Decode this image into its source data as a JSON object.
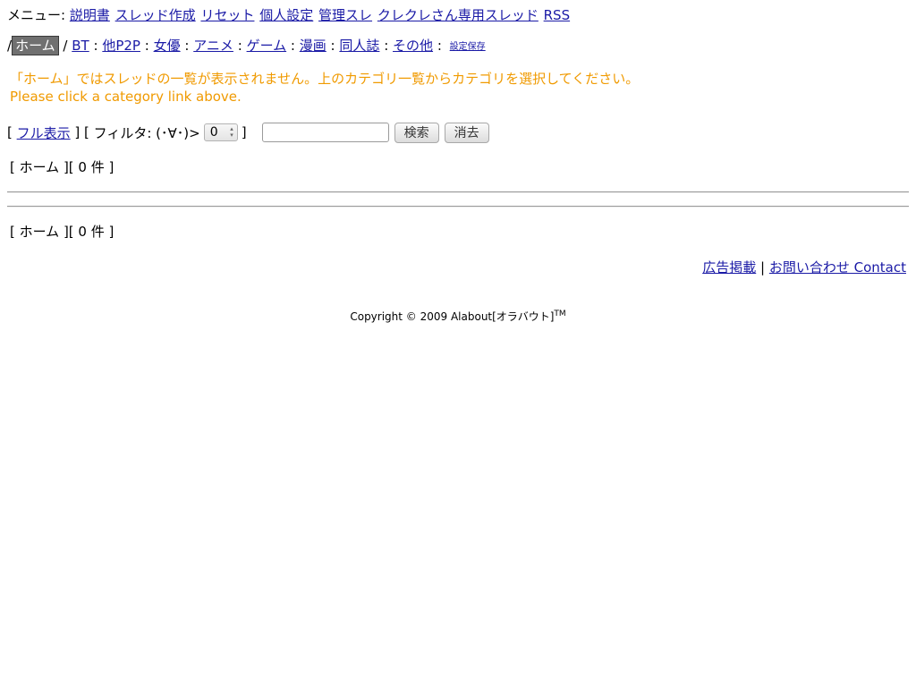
{
  "menu": {
    "label": "メニュー:",
    "items": [
      "説明書",
      "スレッド作成",
      "リセット",
      "個人設定",
      "管理スレ",
      "クレクレさん専用スレッド",
      "RSS"
    ]
  },
  "categories": {
    "active": "ホーム",
    "items": [
      "BT",
      "他P2P",
      "女優",
      "アニメ",
      "ゲーム",
      "漫画",
      "同人誌",
      "その他"
    ],
    "save_label": "設定保存"
  },
  "notice": {
    "ja": "「ホーム」ではスレッドの一覧が表示されません。上のカテゴリ一覧からカテゴリを選択してください。",
    "en": "Please click a category link above."
  },
  "filter": {
    "full_view_label": "フル表示",
    "filter_label": "フィルタ: (･∀･)>",
    "filter_value": "0",
    "search_value": "",
    "search_button": "検索",
    "clear_button": "消去"
  },
  "listing": {
    "count_text": "[ ホーム ][ 0 件 ]"
  },
  "footer": {
    "ads_label": "広告掲載",
    "contact_label": "お問い合わせ Contact",
    "copyright": "Copyright © 2009 Alabout[オラバウト]",
    "tm": "TM"
  },
  "colors": {
    "link": "#1a1aa6",
    "notice": "#f09a00",
    "active_tab_bg": "#707070"
  }
}
